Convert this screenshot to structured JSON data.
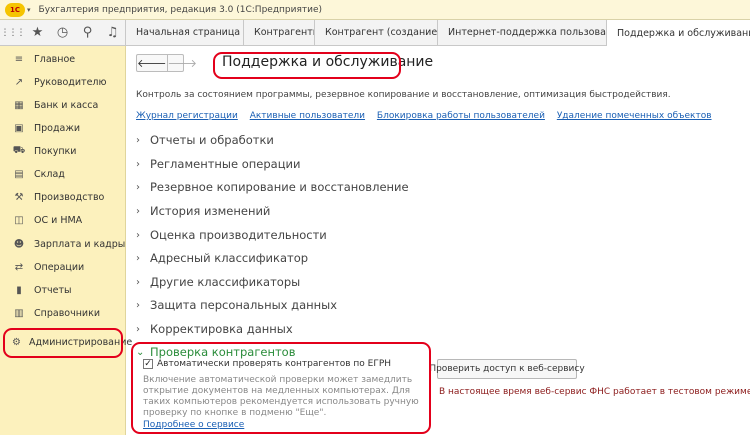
{
  "window": {
    "logo_text": "1С",
    "logo_menu": "▾",
    "title": "Бухгалтерия предприятия, редакция 3.0  (1С:Предприятие)"
  },
  "toolbar": {
    "icons": [
      {
        "name": "apps-grid-icon",
        "glyph": "⋮⋮⋮"
      },
      {
        "name": "favorites-star-icon",
        "glyph": "★"
      },
      {
        "name": "history-clock-icon",
        "glyph": "◷"
      },
      {
        "name": "search-icon",
        "glyph": "⚲"
      },
      {
        "name": "notifications-bell-icon",
        "glyph": "♫"
      }
    ]
  },
  "tabs": [
    {
      "label": "Начальная страница",
      "closable": false
    },
    {
      "label": "Контрагенты",
      "closable": true
    },
    {
      "label": "Контрагент (создание) *",
      "closable": true
    },
    {
      "label": "Интернет-поддержка пользователей",
      "closable": true
    },
    {
      "label": "Поддержка и обслуживание",
      "closable": true,
      "active": true
    }
  ],
  "sidebar": {
    "items": [
      {
        "label": "Главное",
        "icon": "menu-lines-icon",
        "glyph": "≡"
      },
      {
        "label": "Руководителю",
        "icon": "trend-chart-icon",
        "glyph": "↗"
      },
      {
        "label": "Банк и касса",
        "icon": "bank-icon",
        "glyph": "▦"
      },
      {
        "label": "Продажи",
        "icon": "sales-bag-icon",
        "glyph": "▣"
      },
      {
        "label": "Покупки",
        "icon": "shopping-cart-icon",
        "glyph": "⛟"
      },
      {
        "label": "Склад",
        "icon": "warehouse-icon",
        "glyph": "▤"
      },
      {
        "label": "Производство",
        "icon": "factory-icon",
        "glyph": "⚒"
      },
      {
        "label": "ОС и НМА",
        "icon": "assets-icon",
        "glyph": "◫"
      },
      {
        "label": "Зарплата и кадры",
        "icon": "person-icon",
        "glyph": "☻"
      },
      {
        "label": "Операции",
        "icon": "operations-icon",
        "glyph": "⇄"
      },
      {
        "label": "Отчеты",
        "icon": "reports-bar-icon",
        "glyph": "▮"
      },
      {
        "label": "Справочники",
        "icon": "reference-book-icon",
        "glyph": "▥"
      },
      {
        "label": "Администрирование",
        "icon": "gear-icon",
        "glyph": "⚙"
      }
    ]
  },
  "main": {
    "nav_back": "🡐",
    "nav_forward": "🡒",
    "title": "Поддержка и обслуживание",
    "description": "Контроль за состоянием программы, резервное копирование и восстановление, оптимизация быстродействия.",
    "links": [
      "Журнал регистрации",
      "Активные пользователи",
      "Блокировка работы пользователей",
      "Удаление помеченных объектов"
    ],
    "sections": [
      "Отчеты и обработки",
      "Регламентные операции",
      "Резервное копирование и восстановление",
      "История изменений",
      "Оценка производительности",
      "Адресный классификатор",
      "Другие классификаторы",
      "Защита персональных данных",
      "Корректировка данных"
    ],
    "open_section": {
      "title": "Проверка контрагентов",
      "checkbox_label": "Автоматически проверять контрагентов по ЕГРН",
      "checkbox_checked": true,
      "checkmark": "✓",
      "note": "Включение автоматической проверки может замедлить открытие документов на медленных компьютерах. Для таких компьютеров рекомендуется использовать ручную проверку по кнопке в подменю \"Еще\".",
      "more_link": "Подробнее о сервисе",
      "button_label": "Проверить доступ к веб-сервису",
      "status_text": "В настоящее время веб-сервис ФНС работает в тестовом режиме."
    }
  },
  "colors": {
    "highlight": "#e3001b",
    "sidebar_bg": "#fcf1bd",
    "link": "#1a5fb4",
    "open_section": "#2a8c3a",
    "warning": "#8b1a1a"
  }
}
